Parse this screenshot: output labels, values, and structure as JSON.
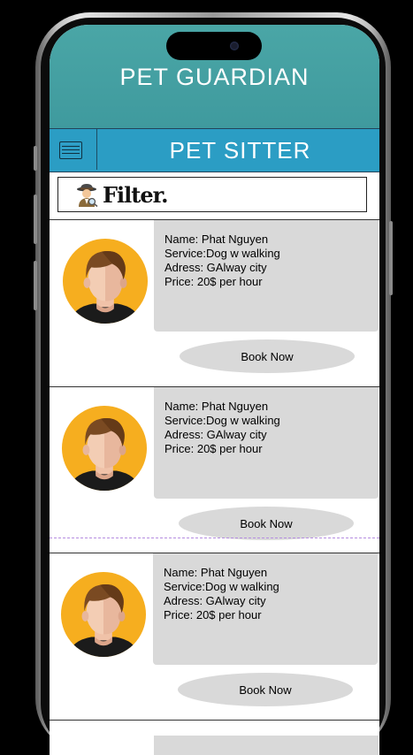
{
  "app": {
    "title": "PET GUARDIAN"
  },
  "section": {
    "title": "PET SITTER",
    "menu_icon": "hamburger-menu-icon"
  },
  "filter": {
    "label": "Filter.",
    "icon": "detective-emoji-icon"
  },
  "colors": {
    "header_bg": "#45a0a2",
    "subheader_bg": "#2b9dc4",
    "card_bg": "#d9d9d9",
    "avatar_bg": "#f6ae1f"
  },
  "sitters": [
    {
      "name_line": "Name: Phat Nguyen",
      "service_line": "Service:Dog w walking",
      "address_line": "Adress: GAlway city",
      "price_line": "Price: 20$ per hour",
      "book_label": "Book Now"
    },
    {
      "name_line": "Name: Phat Nguyen",
      "service_line": "Service:Dog w walking",
      "address_line": "Adress: GAlway city",
      "price_line": "Price: 20$ per hour",
      "book_label": "Book Now"
    },
    {
      "name_line": "Name: Phat Nguyen",
      "service_line": "Service:Dog w walking",
      "address_line": "Adress: GAlway city",
      "price_line": "Price: 20$ per hour",
      "book_label": "Book Now"
    }
  ]
}
